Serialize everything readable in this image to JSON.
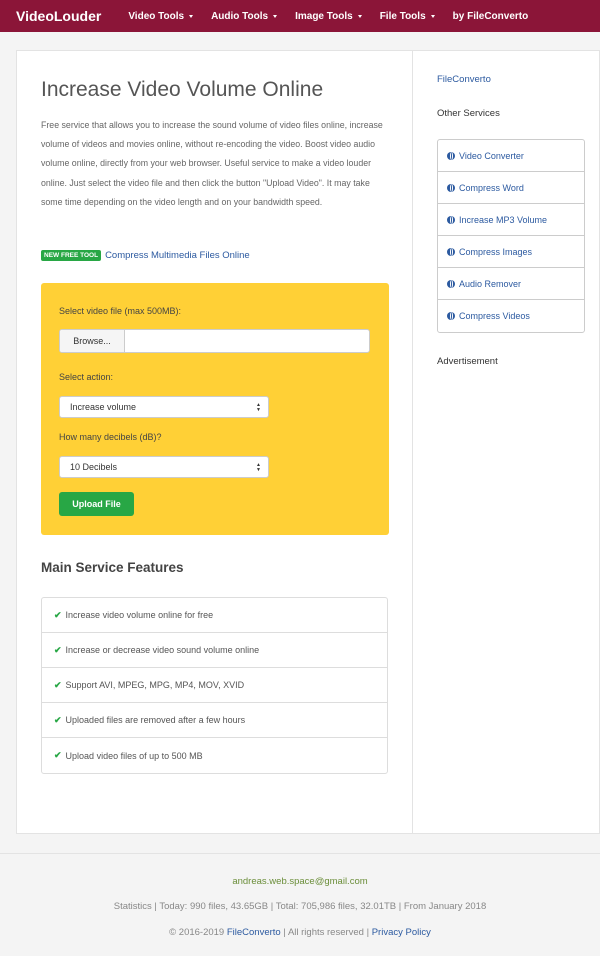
{
  "nav": {
    "brand": "VideoLouder",
    "items": [
      {
        "label": "Video Tools"
      },
      {
        "label": "Audio Tools"
      },
      {
        "label": "Image Tools"
      },
      {
        "label": "File Tools"
      }
    ],
    "by_label": "by FileConverto"
  },
  "main": {
    "title": "Increase Video Volume Online",
    "description": "Free service that allows you to increase the sound volume of video files online, increase volume of videos and movies online, without re-encoding the video. Boost video audio volume online, directly from your web browser. Useful service to make a video louder online. Just select the video file and then click the button \"Upload Video\". It may take some time depending on the video length and on your bandwidth speed.",
    "promo_badge": "NEW FREE TOOL",
    "promo_link": "Compress Multimedia Files Online"
  },
  "form": {
    "file_label": "Select video file (max 500MB):",
    "browse_label": "Browse...",
    "action_label": "Select action:",
    "action_value": "Increase volume",
    "db_label": "How many decibels (dB)?",
    "db_value": "10 Decibels",
    "upload_label": "Upload File"
  },
  "features": {
    "title": "Main Service Features",
    "items": [
      "Increase video volume online for free",
      "Increase or decrease video sound volume online",
      "Support AVI, MPEG, MPG, MP4, MOV, XVID",
      "Uploaded files are removed after a few hours",
      "Upload video files of up to 500 MB"
    ]
  },
  "sidebar": {
    "link": "FileConverto",
    "heading": "Other Services",
    "services": [
      "Video Converter",
      "Compress Word",
      "Increase MP3 Volume",
      "Compress Images",
      "Audio Remover",
      "Compress Videos"
    ],
    "ad_label": "Advertisement"
  },
  "footer": {
    "email": "andreas.web.space@gmail.com",
    "stats": "Statistics | Today: 990 files, 43.65GB | Total: 705,986 files, 32.01TB | From January 2018",
    "copy_prefix": "© 2016-2019",
    "copy_link": "FileConverto",
    "copy_middle": "| All rights reserved |",
    "privacy": "Privacy Policy"
  },
  "colors": {
    "navbar": "#8b1538",
    "form_bg": "#ffd036",
    "accent_green": "#28a745",
    "link": "#2c5aa0"
  }
}
